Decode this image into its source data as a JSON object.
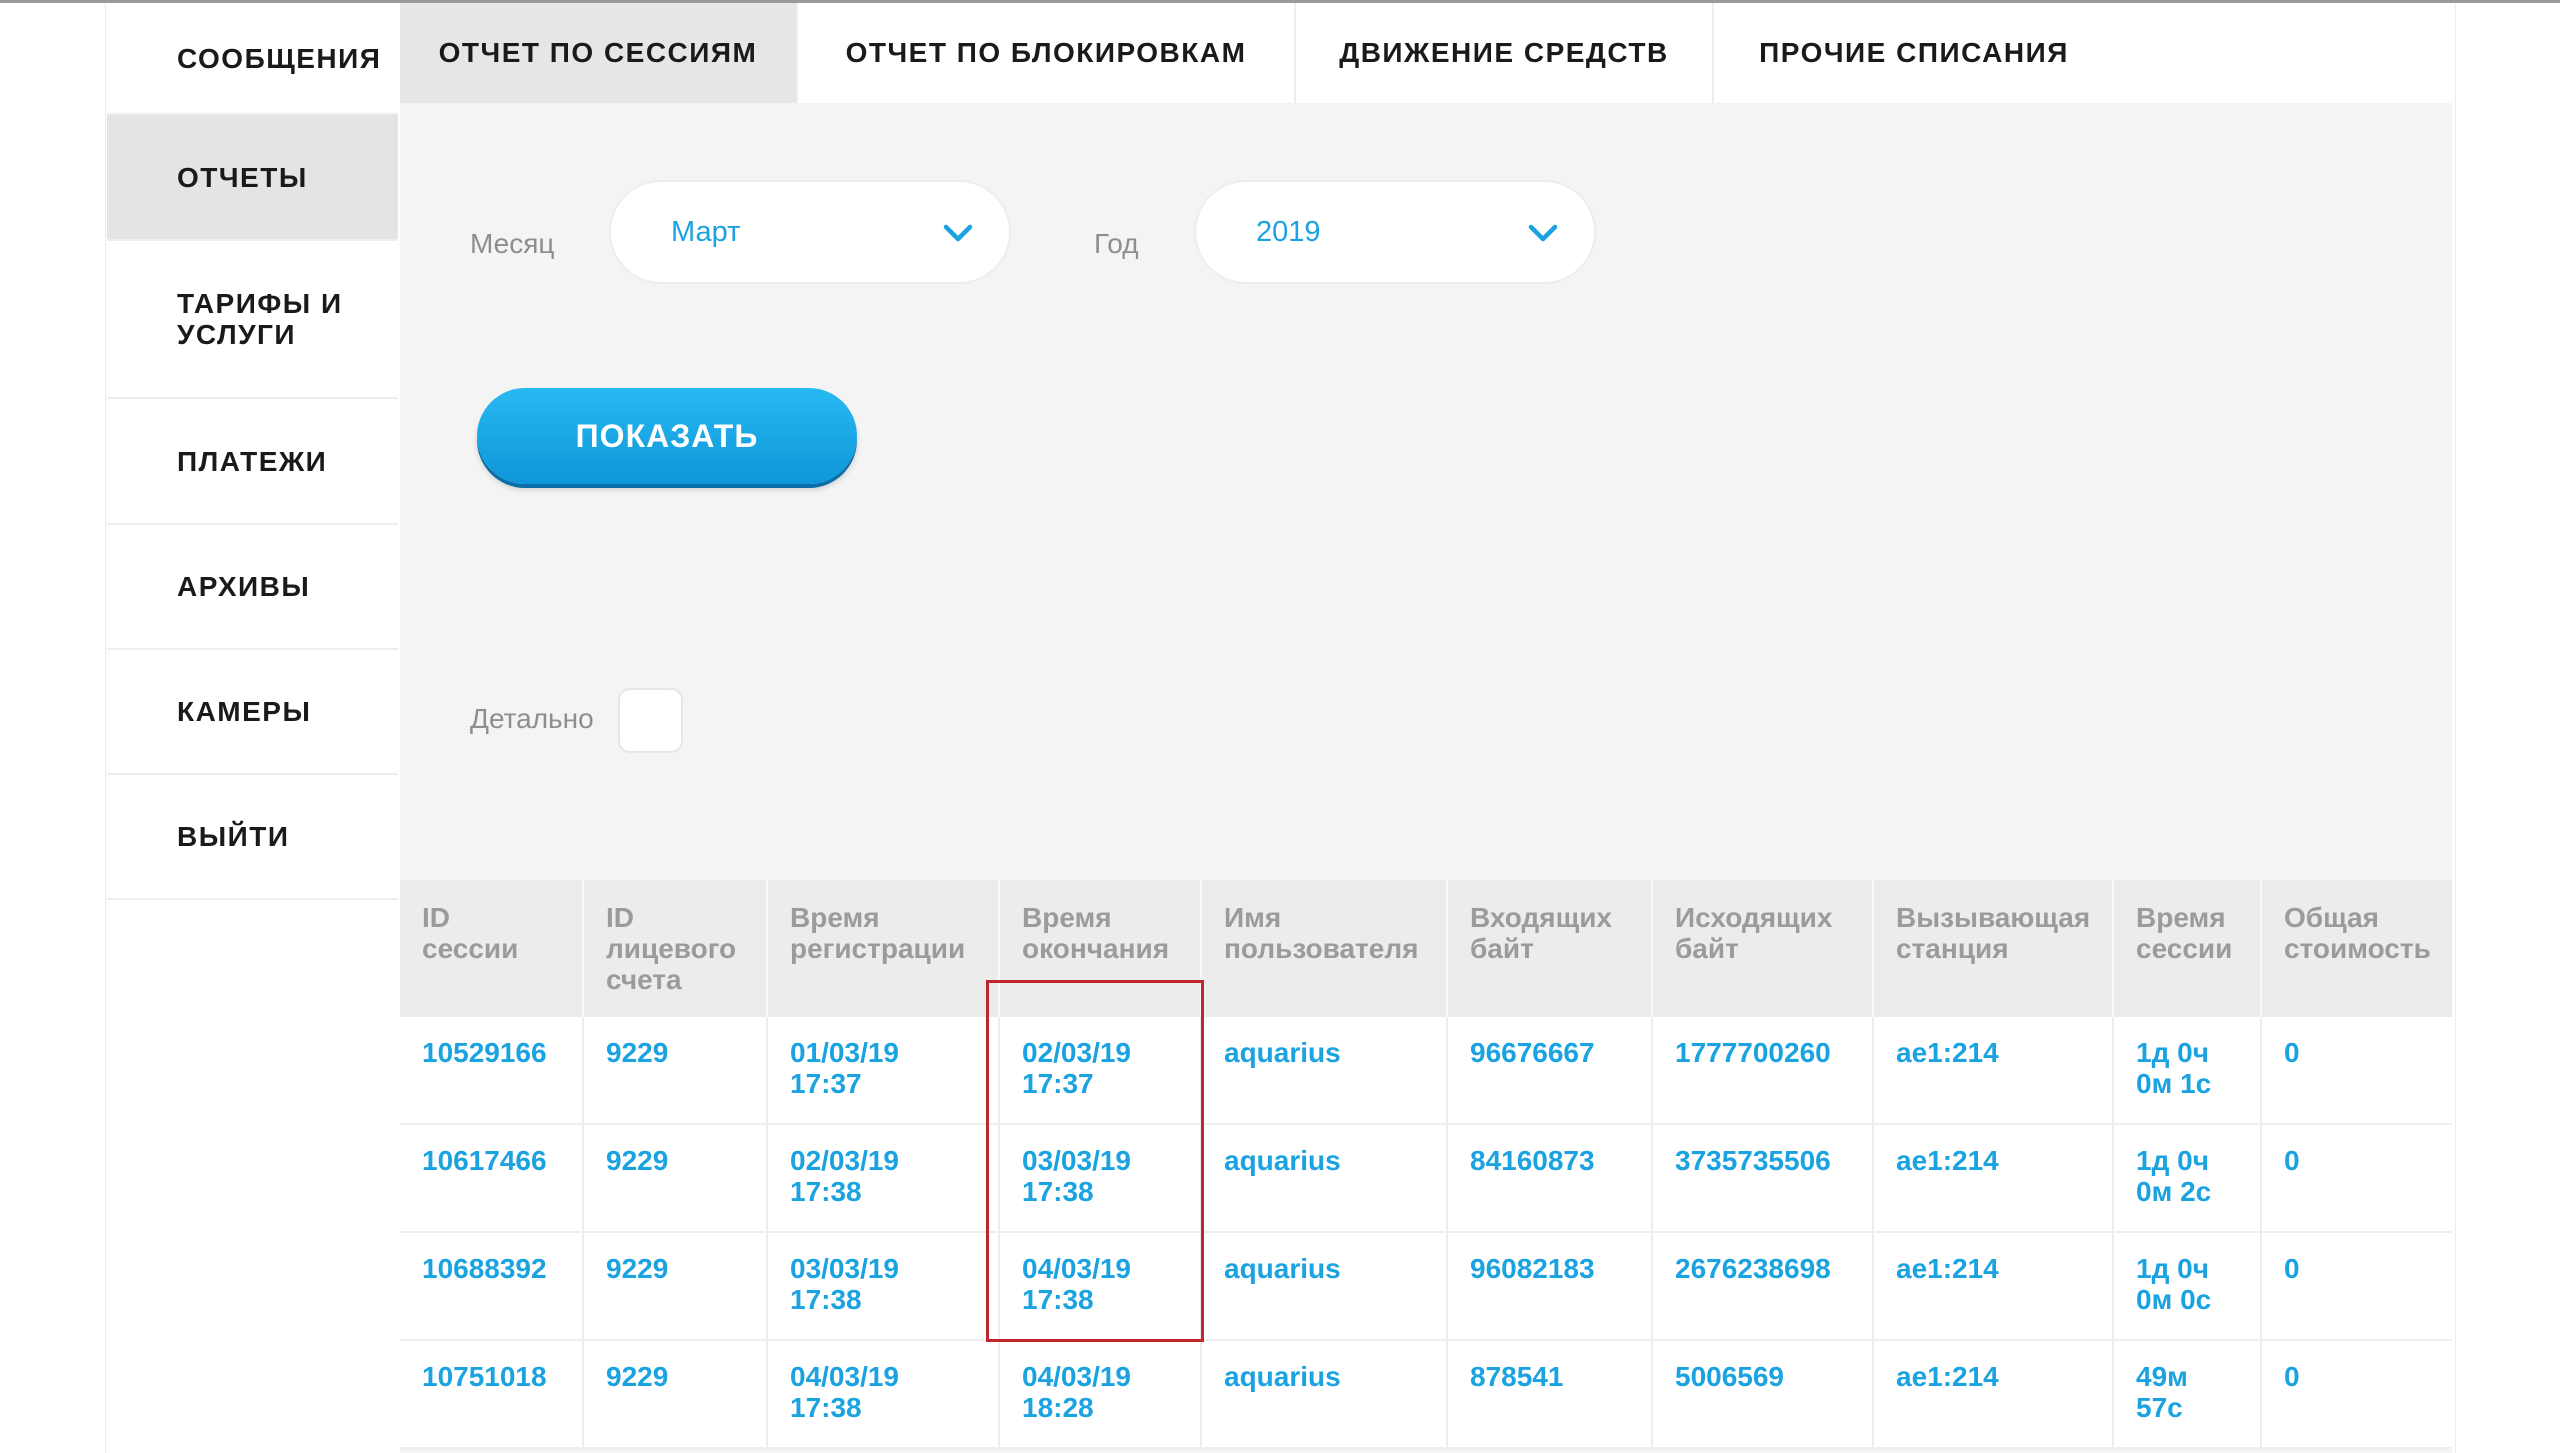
{
  "sidebar": {
    "items": [
      {
        "label": "СООБЩЕНИЯ",
        "active": false
      },
      {
        "label": "ОТЧЕТЫ",
        "active": true
      },
      {
        "label": "ТАРИФЫ И\nУСЛУГИ",
        "active": false
      },
      {
        "label": "ПЛАТЕЖИ",
        "active": false
      },
      {
        "label": "АРХИВЫ",
        "active": false
      },
      {
        "label": "КАМЕРЫ",
        "active": false
      },
      {
        "label": "ВЫЙТИ",
        "active": false
      }
    ]
  },
  "tabs": [
    {
      "label": "ОТЧЕТ ПО СЕССИЯМ",
      "active": true
    },
    {
      "label": "ОТЧЕТ ПО БЛОКИРОВКАМ",
      "active": false
    },
    {
      "label": "ДВИЖЕНИЕ СРЕДСТВ",
      "active": false
    },
    {
      "label": "ПРОЧИЕ СПИСАНИЯ",
      "active": false
    }
  ],
  "filters": {
    "month_label": "Месяц",
    "month_value": "Март",
    "year_label": "Год",
    "year_value": "2019",
    "show_button": "ПОКАЗАТЬ",
    "detail_label": "Детально",
    "detail_checked": false
  },
  "colors": {
    "accent": "#1aa3e0",
    "highlight_frame": "#c0272d"
  },
  "icons": {
    "dropdown": "chevron-down-icon"
  },
  "table": {
    "columns": [
      "ID\nсессии",
      "ID\nлицевого\nсчета",
      "Время\nрегистрации",
      "Время\nокончания",
      "Имя\nпользователя",
      "Входящих\nбайт",
      "Исходящих\nбайт",
      "Вызывающая\nстанция",
      "Время\nсессии",
      "Общая\nстоимость"
    ],
    "rows": [
      [
        "10529166",
        "9229",
        "01/03/19\n17:37",
        "02/03/19\n17:37",
        "aquarius",
        "96676667",
        "1777700260",
        "ae1:214",
        "1д 0ч\n0м 1с",
        "0"
      ],
      [
        "10617466",
        "9229",
        "02/03/19\n17:38",
        "03/03/19\n17:38",
        "aquarius",
        "84160873",
        "3735735506",
        "ae1:214",
        "1д 0ч\n0м 2с",
        "0"
      ],
      [
        "10688392",
        "9229",
        "03/03/19\n17:38",
        "04/03/19\n17:38",
        "aquarius",
        "96082183",
        "2676238698",
        "ae1:214",
        "1д 0ч\n0м 0с",
        "0"
      ],
      [
        "10751018",
        "9229",
        "04/03/19\n17:38",
        "04/03/19\n18:28",
        "aquarius",
        "878541",
        "5006569",
        "ae1:214",
        "49м\n57с",
        "0"
      ]
    ]
  }
}
